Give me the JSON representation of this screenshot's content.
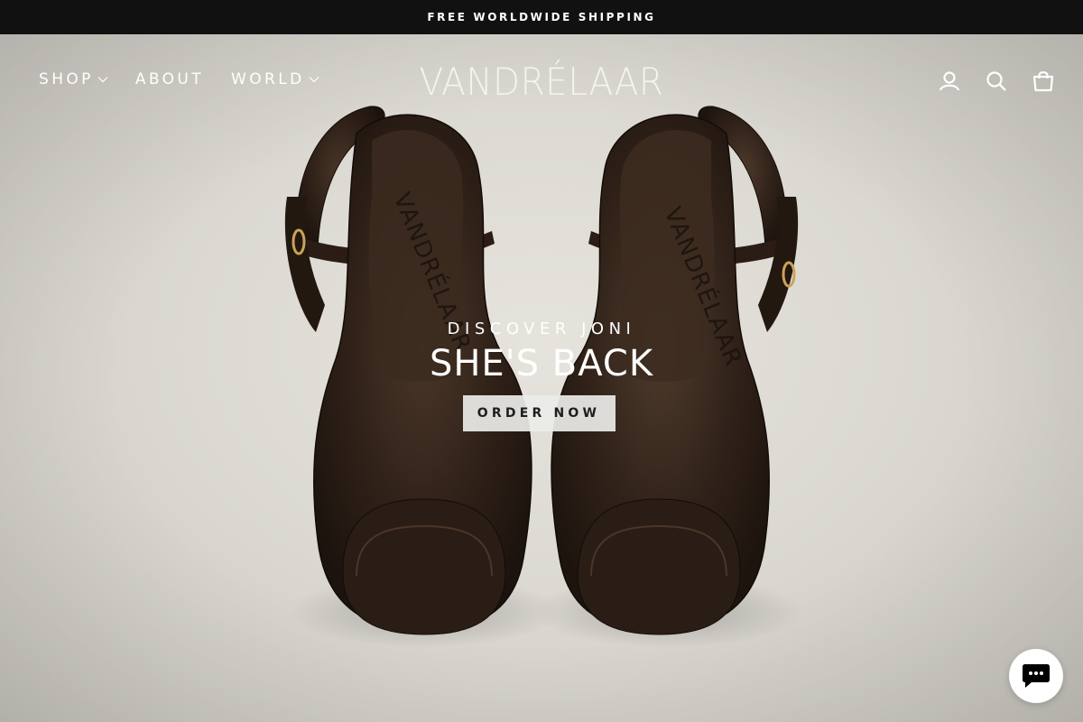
{
  "announcement": {
    "text": "FREE WORLDWIDE SHIPPING"
  },
  "header": {
    "nav": [
      {
        "label": "SHOP",
        "has_dropdown": true
      },
      {
        "label": "ABOUT",
        "has_dropdown": false
      },
      {
        "label": "WORLD",
        "has_dropdown": true
      }
    ],
    "logo": "VANDRÉLAAR",
    "icons": [
      "user-icon",
      "search-icon",
      "cart-icon"
    ],
    "icon_labels": [
      "LOG IN",
      "SEARCH",
      "CART"
    ]
  },
  "hero": {
    "eyebrow": "DISCOVER JONI",
    "headline": "SHE'S BACK",
    "cta_label": "ORDER NOW",
    "insole_brand": "VANDRÉLAAR"
  },
  "chat": {
    "icon": "chat-icon"
  },
  "colors": {
    "announcement_bg": "#111111",
    "leather": "#2b1d15",
    "backdrop": "#dcd9d3",
    "cta_bg": "#ecebe8",
    "chat_icon": "#000000"
  }
}
